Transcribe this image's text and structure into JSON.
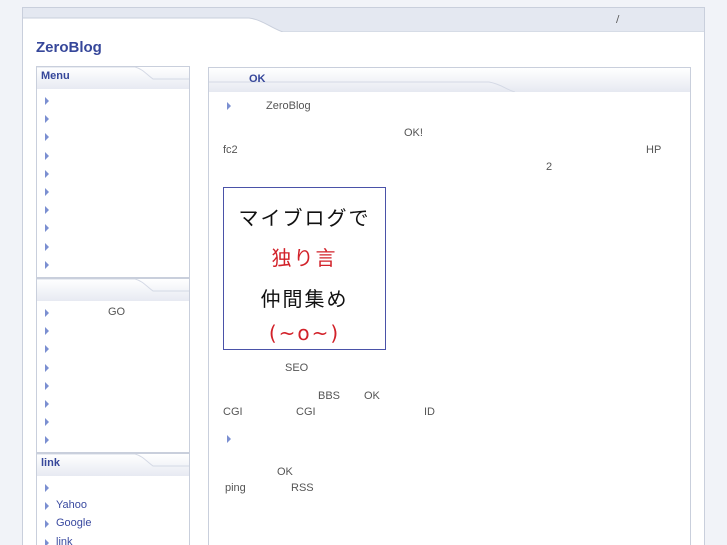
{
  "topbar": {
    "separator": "/"
  },
  "site": {
    "title": "ZeroBlog"
  },
  "sidebar": {
    "menu": {
      "title": "Menu",
      "items": [
        "",
        "",
        "",
        "",
        "",
        "",
        "",
        "",
        "",
        ""
      ]
    },
    "second": {
      "title": "",
      "go_label": "GO",
      "items": [
        "",
        "",
        "",
        "",
        "",
        "",
        "",
        ""
      ]
    },
    "links": {
      "title": "link",
      "items": [
        "",
        "Yahoo",
        "Google",
        "link"
      ]
    }
  },
  "main": {
    "title": "OK",
    "para1": {
      "brand": "ZeroBlog"
    },
    "para2": {
      "ok": "OK!",
      "fc2": "fc2",
      "hp": "HP",
      "num": "2"
    },
    "banner": {
      "line1": "マイブログで",
      "line2": "独り言",
      "line3": "仲間集め",
      "line4": "(~o~)",
      "color_dark": "#111111",
      "color_red": "#d2222a"
    },
    "para3": {
      "seo": "SEO",
      "bbs": "BBS",
      "ok": "OK",
      "cgi1": "CGI",
      "cgi2": "CGI",
      "id": "ID"
    },
    "para4": {
      "ok": "OK",
      "ping": "ping",
      "rss": "RSS"
    }
  }
}
